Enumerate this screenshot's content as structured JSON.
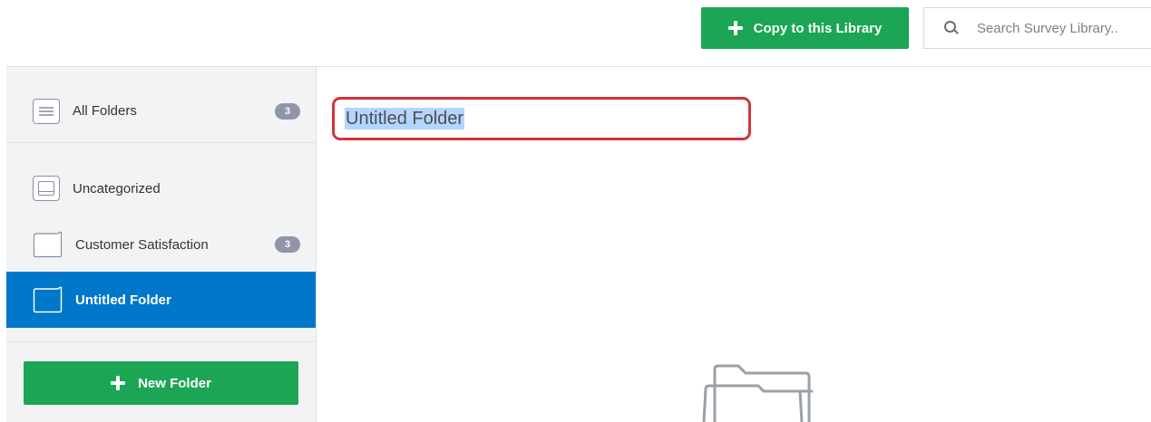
{
  "toolbar": {
    "copy_button_label": "Copy to this Library",
    "copy_button_icon": "plus-icon",
    "search_placeholder": "Search Survey Library..",
    "search_icon": "magnifier-icon"
  },
  "sidebar": {
    "items": [
      {
        "label": "All Folders",
        "icon": "list-icon",
        "count": "3",
        "selected": false
      },
      {
        "label": "Uncategorized",
        "icon": "tray-icon",
        "selected": false
      },
      {
        "label": "Customer Satisfaction",
        "icon": "folder-icon",
        "count": "3",
        "selected": false
      },
      {
        "label": "Untitled Folder",
        "icon": "folder-icon",
        "selected": true
      }
    ],
    "new_folder_label": "New Folder",
    "new_folder_icon": "plus-icon"
  },
  "main": {
    "folder_title_value": "Untitled Folder",
    "empty_state_icon": "open-folder-icon"
  },
  "colors": {
    "accent_green": "#1ba554",
    "selected_blue": "#0077c8",
    "edit_border_red": "#d2343c",
    "badge_gray": "#8e96a8",
    "text_selection": "#b4d5fe"
  }
}
